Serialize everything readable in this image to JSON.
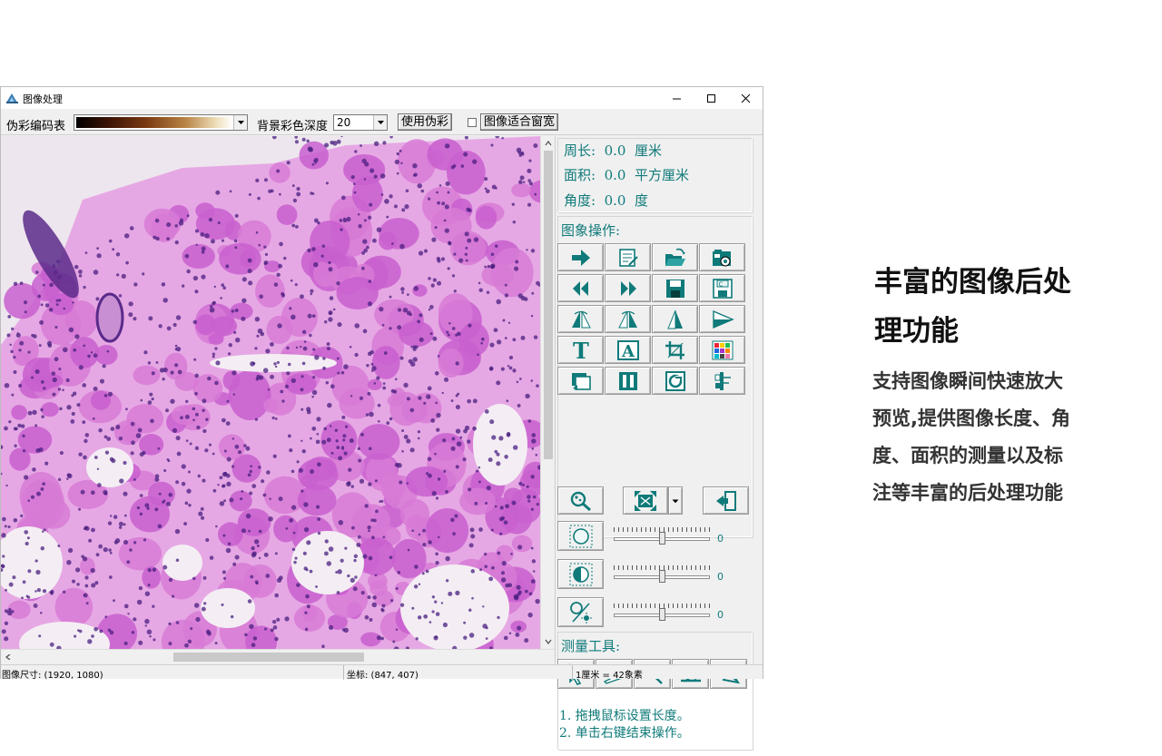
{
  "window": {
    "title": "图像处理",
    "minimize_icon": "minimize-icon",
    "maximize_icon": "maximize-icon",
    "close_icon": "close-icon"
  },
  "toolbar": {
    "colormap_label": "伪彩编码表",
    "depth_label": "背景彩色深度",
    "depth_value": "20",
    "apply_pseudocolor_label": "使用伪彩",
    "fit_width_label": "图像适合窗宽",
    "fit_width_checked": false
  },
  "measurements": {
    "perimeter": "周长:  0.0  厘米",
    "area": "面积:  0.0  平方厘米",
    "angle": "角度:  0.0  度"
  },
  "image_ops": {
    "title": "图象操作:",
    "buttons": [
      {
        "name": "next-icon"
      },
      {
        "name": "edit-notes-icon"
      },
      {
        "name": "open-folder-icon"
      },
      {
        "name": "camera-icon"
      },
      {
        "name": "rewind-icon"
      },
      {
        "name": "fast-forward-icon"
      },
      {
        "name": "save-icon"
      },
      {
        "name": "save-copy-icon"
      },
      {
        "name": "flip-left-icon"
      },
      {
        "name": "flip-right-icon"
      },
      {
        "name": "flip-vertical-icon"
      },
      {
        "name": "rotate-icon"
      },
      {
        "name": "text-icon"
      },
      {
        "name": "text-box-icon"
      },
      {
        "name": "crop-icon"
      },
      {
        "name": "color-palette-icon"
      },
      {
        "name": "copy-icon"
      },
      {
        "name": "split-icon"
      },
      {
        "name": "paste-icon"
      },
      {
        "name": "mirror-icon"
      }
    ],
    "zoom_icon": "magnify-icon",
    "fit_icon": "fit-window-icon",
    "exit_icon": "exit-door-icon"
  },
  "sliders": [
    {
      "name": "brightness",
      "icon": "brightness-icon",
      "value": "0",
      "level": 0.5
    },
    {
      "name": "contrast",
      "icon": "contrast-icon",
      "value": "0",
      "level": 0.5
    },
    {
      "name": "gamma",
      "icon": "gamma-icon",
      "value": "0",
      "level": 0.5
    }
  ],
  "measure_tools": {
    "title": "测量工具:",
    "tools": [
      {
        "name": "pointer-icon"
      },
      {
        "name": "ruler-icon"
      },
      {
        "name": "line-icon"
      },
      {
        "name": "angle-icon"
      },
      {
        "name": "polygon-icon"
      }
    ],
    "help": [
      "1. 拖拽鼠标设置长度。",
      "2. 单击右键结束操作。"
    ]
  },
  "status": {
    "image_size": "图像尺寸: (1920, 1080)",
    "coordinates": "坐标: (847, 407)",
    "scale": "1厘米 = 42象素"
  },
  "promo": {
    "title_line1": "丰富的图像后处",
    "title_line2": "理功能",
    "desc_line1": "支持图像瞬间快速放大",
    "desc_line2": "预览,提供图像长度、角",
    "desc_line3": "度、面积的测量以及标",
    "desc_line4": "注等丰富的后处理功能"
  },
  "colors": {
    "accent": "#107a7a",
    "tissue_pink": "#d77ad6",
    "nuclei_purple": "#4a1f80"
  }
}
